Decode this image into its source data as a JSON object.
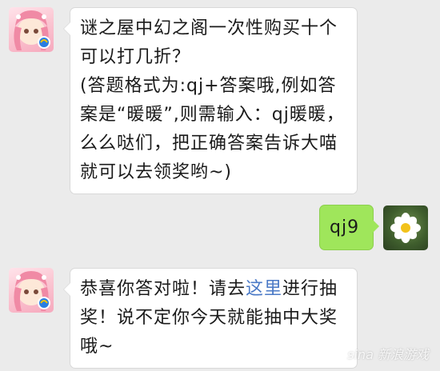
{
  "messages": [
    {
      "from": "bot",
      "text": "谜之屋中幻之阁一次性购买十个可以打几折？\n(答题格式为:qj+答案哦,例如答案是“暖暖”,则需输入：qj暖暖，么么哒们，把正确答案告诉大喵就可以去领奖哟~)"
    },
    {
      "from": "user",
      "text": "qj9"
    },
    {
      "from": "bot",
      "text_before_link": "恭喜你答对啦！请去",
      "link_text": "这里",
      "text_after_link": "进行抽奖！说不定你今天就能抽中大奖哦~"
    }
  ],
  "watermark": "sina 新浪游戏",
  "colors": {
    "background": "#ebebeb",
    "bot_bubble": "#ffffff",
    "user_bubble": "#9fe65b",
    "link": "#4a79c6"
  }
}
